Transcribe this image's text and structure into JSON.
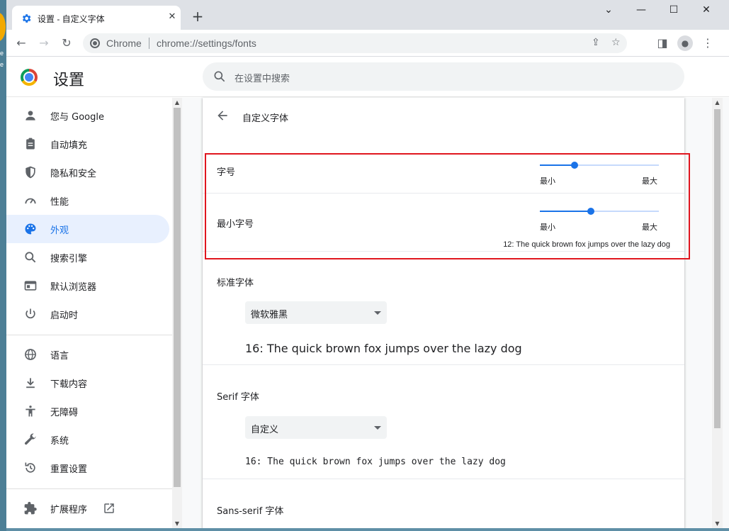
{
  "desktop": {
    "edge_text_1": "e",
    "edge_text_2": "e"
  },
  "tab": {
    "title": "设置 - 自定义字体",
    "close_glyph": "✕"
  },
  "new_tab_glyph": "+",
  "window_controls": {
    "minimize": "⌄",
    "min2": "—",
    "maximize": "☐",
    "close": "✕"
  },
  "toolbar": {
    "back": "←",
    "forward": "→",
    "reload": "↻",
    "origin": "Chrome",
    "url": "chrome://settings/fonts",
    "share": "⇪",
    "star": "☆",
    "sidepanel": "◨",
    "profile": "●",
    "menu": "⋮"
  },
  "settings": {
    "title": "设置",
    "search_placeholder": "在设置中搜索"
  },
  "sidebar": {
    "items": [
      {
        "label": "您与 Google",
        "icon": "person-icon"
      },
      {
        "label": "自动填充",
        "icon": "clipboard-icon"
      },
      {
        "label": "隐私和安全",
        "icon": "shield-icon"
      },
      {
        "label": "性能",
        "icon": "speedometer-icon"
      },
      {
        "label": "外观",
        "icon": "palette-icon"
      },
      {
        "label": "搜索引擎",
        "icon": "search-icon"
      },
      {
        "label": "默认浏览器",
        "icon": "browser-icon"
      },
      {
        "label": "启动时",
        "icon": "power-icon"
      },
      {
        "label": "语言",
        "icon": "globe-icon"
      },
      {
        "label": "下载内容",
        "icon": "download-icon"
      },
      {
        "label": "无障碍",
        "icon": "accessibility-icon"
      },
      {
        "label": "系统",
        "icon": "wrench-icon"
      },
      {
        "label": "重置设置",
        "icon": "reset-icon"
      },
      {
        "label": "扩展程序",
        "icon": "puzzle-icon"
      }
    ],
    "active_index": 4
  },
  "main": {
    "subtitle": "自定义字体",
    "font_size": {
      "label": "字号",
      "min_label": "最小",
      "max_label": "最大",
      "level": 0.29
    },
    "min_font_size": {
      "label": "最小字号",
      "min_label": "最小",
      "max_label": "最大",
      "level": 0.43,
      "sample": "12: The quick brown fox jumps over the lazy dog"
    },
    "standard_font": {
      "label": "标准字体",
      "value": "微软雅黑",
      "sample": "16: The quick brown fox jumps over the lazy dog"
    },
    "serif_font": {
      "label": "Serif 字体",
      "value": "自定义",
      "sample": "16: The quick brown fox jumps over the lazy dog"
    },
    "sans_serif_font": {
      "label": "Sans-serif 字体"
    }
  },
  "colors": {
    "accent": "#1a73e8",
    "highlight_box": "#e0161f"
  }
}
